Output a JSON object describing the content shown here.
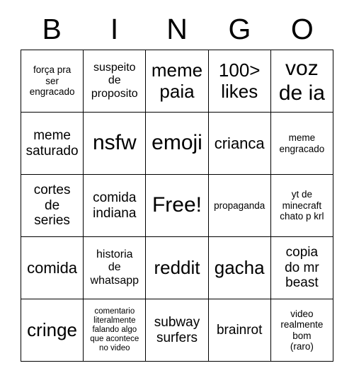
{
  "card": {
    "title": "BINGO",
    "header_letters": [
      "B",
      "I",
      "N",
      "G",
      "O"
    ],
    "free_space_label": "Free!",
    "free_space_position": {
      "row": 3,
      "column": 3
    },
    "grid_size": "5x5",
    "colors": {
      "background": "#ffffff",
      "text": "#000000",
      "border": "#000000"
    },
    "rows": [
      {
        "cells": [
          {
            "text": "força pra\nser\nengracado",
            "size": "xs"
          },
          {
            "text": "suspeito\nde\nproposito",
            "size": "sm"
          },
          {
            "text": "meme\npaia",
            "size": "xl"
          },
          {
            "text": "100>\nlikes",
            "size": "xl"
          },
          {
            "text": "voz\nde ia",
            "size": "xxl"
          }
        ]
      },
      {
        "cells": [
          {
            "text": "meme\nsaturado",
            "size": "md"
          },
          {
            "text": "nsfw",
            "size": "xxl"
          },
          {
            "text": "emoji",
            "size": "xxl"
          },
          {
            "text": "crianca",
            "size": "lg"
          },
          {
            "text": "meme\nengracado",
            "size": "xs"
          }
        ]
      },
      {
        "cells": [
          {
            "text": "cortes\nde\nseries",
            "size": "md"
          },
          {
            "text": "comida\nindiana",
            "size": "md"
          },
          {
            "text": "Free!",
            "size": "xxl"
          },
          {
            "text": "propaganda",
            "size": "xs"
          },
          {
            "text": "yt de\nminecraft\nchato p krl",
            "size": "xs"
          }
        ]
      },
      {
        "cells": [
          {
            "text": "comida",
            "size": "lg"
          },
          {
            "text": "historia\nde\nwhatsapp",
            "size": "sm"
          },
          {
            "text": "reddit",
            "size": "xl"
          },
          {
            "text": "gacha",
            "size": "xl"
          },
          {
            "text": "copia\ndo mr\nbeast",
            "size": "md"
          }
        ]
      },
      {
        "cells": [
          {
            "text": "cringe",
            "size": "xl"
          },
          {
            "text": "comentario\nliteralmente\nfalando algo\nque acontece\nno video",
            "size": "xxs"
          },
          {
            "text": "subway\nsurfers",
            "size": "md"
          },
          {
            "text": "brainrot",
            "size": "md"
          },
          {
            "text": "video\nrealmente\nbom\n(raro)",
            "size": "xs"
          }
        ]
      }
    ]
  }
}
